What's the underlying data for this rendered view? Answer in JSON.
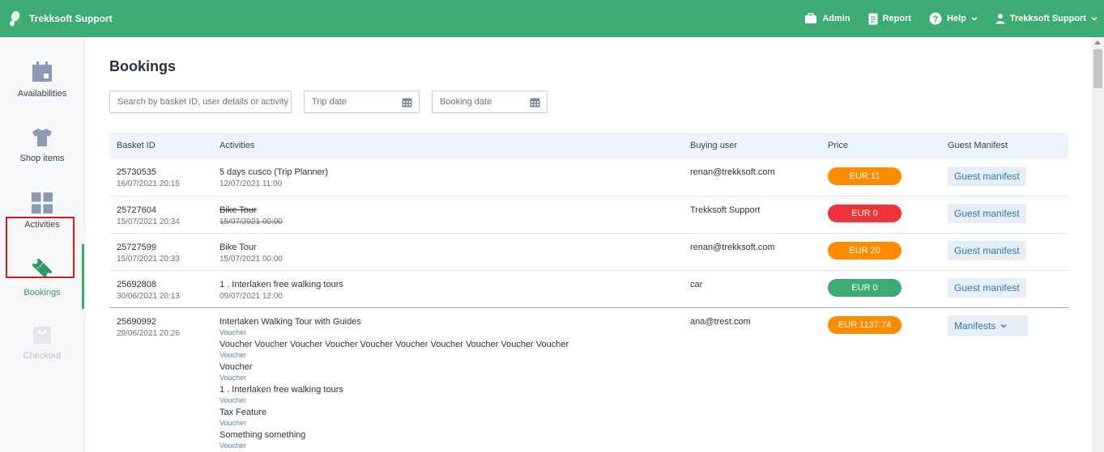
{
  "brand": {
    "name": "Trekksoft Support"
  },
  "topnav": {
    "admin": "Admin",
    "report": "Report",
    "help": "Help",
    "user": "Trekksoft Support"
  },
  "sidebar": {
    "items": [
      {
        "label": "Availabilities",
        "icon": "calendar-icon"
      },
      {
        "label": "Shop items",
        "icon": "shirt-icon"
      },
      {
        "label": "Activities",
        "icon": "grid-icon"
      },
      {
        "label": "Bookings",
        "icon": "ticket-icon"
      },
      {
        "label": "Checkout",
        "icon": "shopping-bag-icon"
      }
    ]
  },
  "page": {
    "title": "Bookings"
  },
  "filters": {
    "search_placeholder": "Search by basket ID, user details or activity",
    "trip_date_placeholder": "Trip date",
    "booking_date_placeholder": "Booking date"
  },
  "table": {
    "headers": {
      "basket_id": "Basket ID",
      "activities": "Activities",
      "buying_user": "Buying user",
      "price": "Price",
      "guest_manifest": "Guest Manifest"
    },
    "rows": [
      {
        "basket_id": "25730535",
        "booked": "16/07/2021 20:15",
        "activity": "5 days cusco (Trip Planner)",
        "activity_date": "12/07/2021 11:00",
        "user": "renan@trekksoft.com",
        "price": "EUR 11",
        "price_color": "#ff8c00",
        "manifest": "Guest manifest"
      },
      {
        "basket_id": "25727604",
        "booked": "15/07/2021 20:34",
        "activity": "Bike Tour",
        "activity_date": "15/07/2021 00:00",
        "user": "Trekksoft Support",
        "price": "EUR 0",
        "price_color": "#ef3338",
        "manifest": "Guest manifest"
      },
      {
        "basket_id": "25727599",
        "booked": "15/07/2021 20:33",
        "activity": "Bike Tour",
        "activity_date": "15/07/2021 00:00",
        "user": "renan@trekksoft.com",
        "price": "EUR 20",
        "price_color": "#ff8c00",
        "manifest": "Guest manifest"
      },
      {
        "basket_id": "25692808",
        "booked": "30/06/2021 20:13",
        "activity": "1 . Interlaken free walking tours",
        "activity_date": "09/07/2021 12:00",
        "user": "car",
        "price": "EUR 0",
        "price_color": "#3dab74",
        "manifest": "Guest manifest"
      },
      {
        "basket_id": "25690992",
        "booked": "29/06/2021 20:26",
        "activities": [
          {
            "name": "Interlaken Walking Tour with Guides",
            "type": "Voucher"
          },
          {
            "name": "Voucher Voucher Voucher Voucher Voucher Voucher Voucher Voucher Voucher Voucher",
            "type": "Voucher"
          },
          {
            "name": "Voucher",
            "type": "Voucher"
          },
          {
            "name": "1 . Interlaken free walking tours",
            "type": "Voucher"
          },
          {
            "name": "Tax Feature",
            "type": "Voucher"
          },
          {
            "name": "Something something",
            "type": "Voucher"
          }
        ],
        "user": "ana@trest.com",
        "price": "EUR 1137.74",
        "price_color": "#ff8c00",
        "manifest": "Manifests"
      }
    ]
  },
  "colors": {
    "accent": "#3dab74",
    "highlight": "#e0161d"
  }
}
